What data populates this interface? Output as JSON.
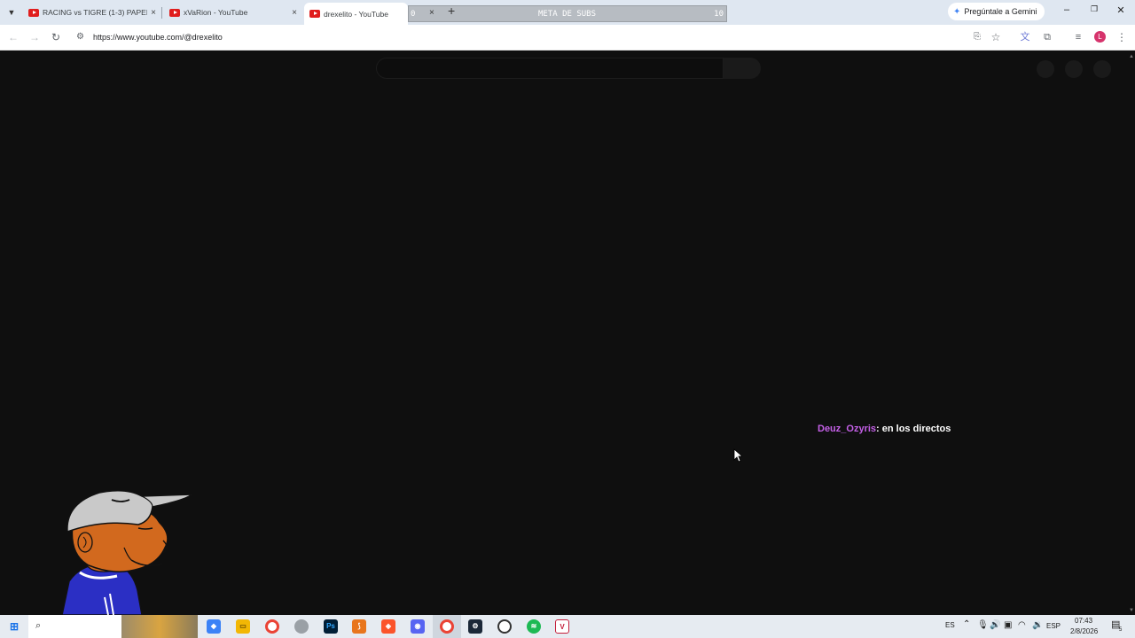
{
  "browser": {
    "tabs": [
      {
        "title": "RACING vs TIGRE (1-3) PAPELÓ",
        "close": "×"
      },
      {
        "title": "xVaRion - YouTube",
        "close": "×"
      },
      {
        "title": "drexelito - YouTube",
        "close": "×",
        "active": true
      }
    ],
    "meta_bar": {
      "left": "0",
      "center": "META DE SUBS",
      "right": "10",
      "close": "×"
    },
    "new_tab": "+",
    "gemini_label": "Pregúntale a Gemini",
    "window_controls": {
      "minimize": "–",
      "restore": "❐",
      "close": "✕"
    },
    "url": "https://www.youtube.com/@drexelito",
    "profile_initial": "L"
  },
  "chat": {
    "user": "Deuz_Ozyris",
    "message": ": en los directos"
  },
  "taskbar": {
    "tray_lang": "ES",
    "tray_keyboard": "ESP",
    "time": "07:43",
    "date": "2/8/2026",
    "notification_count": "5"
  },
  "colors": {
    "chat_user": "#c560e8",
    "youtube_red": "#e01e1e",
    "page_bg": "#0f0f0f"
  }
}
